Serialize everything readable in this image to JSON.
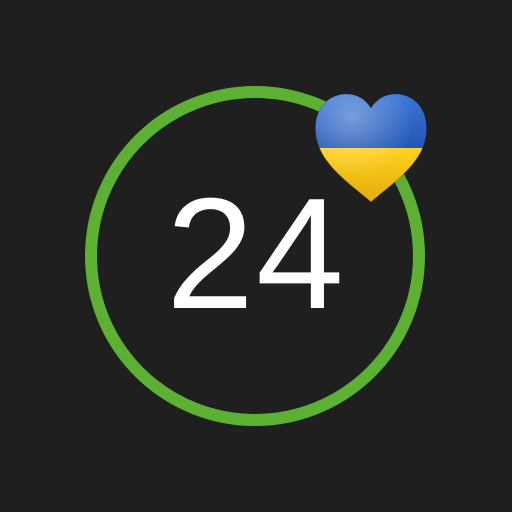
{
  "icon": {
    "number": "24",
    "background_color": "#1f1f1f",
    "ring_color": "#5cb132",
    "text_color": "#ffffff",
    "heart": {
      "name": "ukraine-flag-heart-icon",
      "top_color": "#2a63c4",
      "bottom_color": "#f2c416"
    }
  }
}
